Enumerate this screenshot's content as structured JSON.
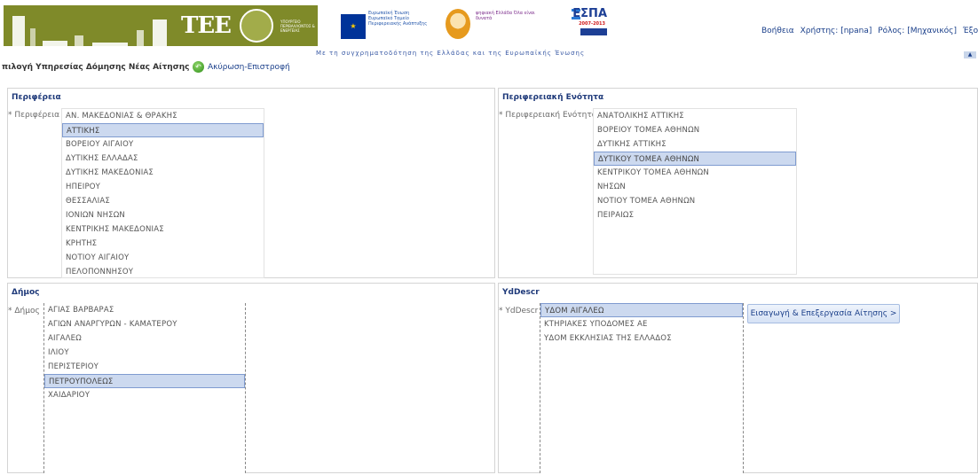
{
  "header": {
    "logos": {
      "tee": "TEE",
      "ministry": "ΥΠΟΥΡΓΕΙΟ ΠΕΡΙΒΑΛΛΟΝΤΟΣ & ΕΝΕΡΓΕΙΑΣ",
      "eu_text": "Ευρωπαϊκή Ένωση Ευρωπαϊκό Ταμείο Περιφερειακής Ανάπτυξης",
      "ep_text": "ψηφιακή Ελλάδα Όλα είναι δυνατά",
      "espa": "ΕΣΠΑ",
      "espa_years": "2007-2013"
    },
    "cofund_text": "Με τη συγχρηματοδότηση της Ελλάδας και της Ευρωπαϊκής Ένωσης",
    "links": {
      "help": "Βοήθεια",
      "user": "Χρήστης: [npana]",
      "role": "Ρόλος: [Μηχανικός]",
      "exit": "Έξοδ"
    }
  },
  "page": {
    "title": "πιλογή Υπηρεσίας Δόμησης Νέας Αίτησης",
    "cancel": "Ακύρωση-Επιστροφή"
  },
  "panels": {
    "region": {
      "title": "Περιφέρεια",
      "label": "* Περιφέρεια",
      "items": [
        "ΑΝ. ΜΑΚΕΔΟΝΙΑΣ & ΘΡΑΚΗΣ",
        "ΑΤΤΙΚΗΣ",
        "ΒΟΡΕΙΟΥ ΑΙΓΑΙΟΥ",
        "ΔΥΤΙΚΗΣ ΕΛΛΑΔΑΣ",
        "ΔΥΤΙΚΗΣ ΜΑΚΕΔΟΝΙΑΣ",
        "ΗΠΕΙΡΟΥ",
        "ΘΕΣΣΑΛΙΑΣ",
        "ΙΟΝΙΩΝ ΝΗΣΩΝ",
        "ΚΕΝΤΡΙΚΗΣ ΜΑΚΕΔΟΝΙΑΣ",
        "ΚΡΗΤΗΣ",
        "ΝΟΤΙΟΥ ΑΙΓΑΙΟΥ",
        "ΠΕΛΟΠΟΝΝΗΣΟΥ"
      ],
      "selected": "ΑΤΤΙΚΗΣ"
    },
    "unit": {
      "title": "Περιφερειακή Ενότητα",
      "label": "* Περιφερειακή Ενότητα",
      "items": [
        "ΑΝΑΤΟΛΙΚΗΣ ΑΤΤΙΚΗΣ",
        "ΒΟΡΕΙΟΥ ΤΟΜΕΑ ΑΘΗΝΩΝ",
        "ΔΥΤΙΚΗΣ ΑΤΤΙΚΗΣ",
        "ΔΥΤΙΚΟΥ ΤΟΜΕΑ ΑΘΗΝΩΝ",
        "ΚΕΝΤΡΙΚΟΥ ΤΟΜΕΑ ΑΘΗΝΩΝ",
        "ΝΗΣΩΝ",
        "ΝΟΤΙΟΥ ΤΟΜΕΑ ΑΘΗΝΩΝ",
        "ΠΕΙΡΑΙΩΣ"
      ],
      "selected": "ΔΥΤΙΚΟΥ ΤΟΜΕΑ ΑΘΗΝΩΝ"
    },
    "municipality": {
      "title": "Δήμος",
      "label": "* Δήμος",
      "items": [
        "ΑΓΙΑΣ ΒΑΡΒΑΡΑΣ",
        "ΑΓΙΩΝ ΑΝΑΡΓΥΡΩΝ - ΚΑΜΑΤΕΡΟΥ",
        "ΑΙΓΑΛΕΩ",
        "ΙΛΙΟΥ",
        "ΠΕΡΙΣΤΕΡΙΟΥ",
        "ΠΕΤΡΟΥΠΟΛΕΩΣ",
        "ΧΑΙΔΑΡΙΟΥ"
      ],
      "selected": "ΠΕΤΡΟΥΠΟΛΕΩΣ"
    },
    "ydom": {
      "title": "YdDescr",
      "label": "* YdDescr",
      "items": [
        "ΥΔΟΜ ΑΙΓΑΛΕΩ",
        "ΚΤΗΡΙΑΚΕΣ ΥΠΟΔΟΜΕΣ ΑΕ",
        "ΥΔΟΜ ΕΚΚΛΗΣΙΑΣ ΤΗΣ ΕΛΛΑΔΟΣ"
      ],
      "selected": "ΥΔΟΜ ΑΙΓΑΛΕΩ",
      "submit": "Εισαγωγή & Επεξεργασία Αίτησης >"
    }
  },
  "colors": {
    "banner_olive": "#7f8a29",
    "title_blue": "#1f3a7a",
    "selection": "#ccd9ef"
  },
  "icons": [
    "green-circle-icon",
    "collapse-up-icon",
    "eu-flag-icon",
    "person-icon",
    "espa-logo"
  ]
}
